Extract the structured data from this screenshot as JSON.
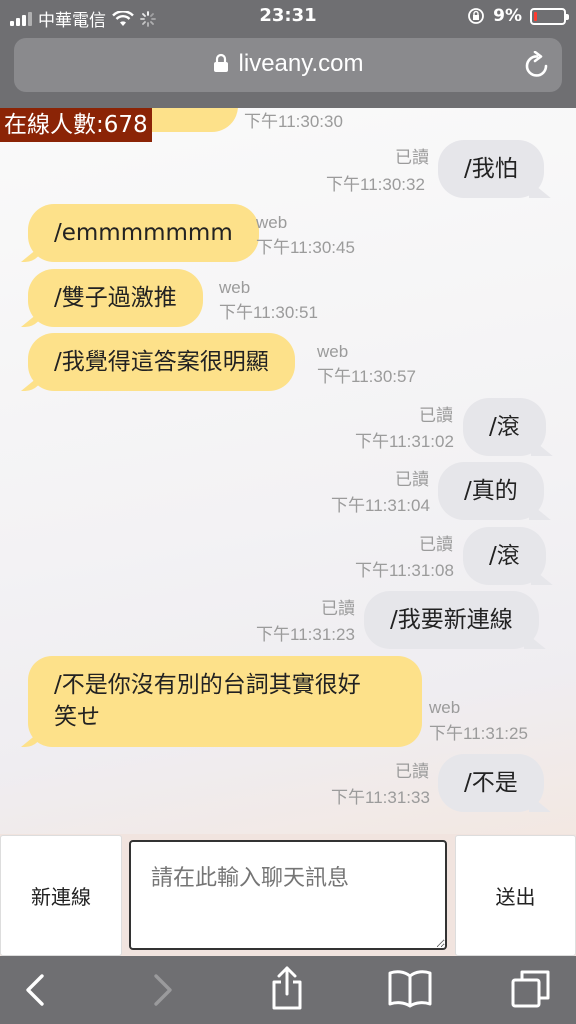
{
  "status_bar": {
    "carrier": "中華電信",
    "time": "23:31",
    "battery_percent": "9%",
    "battery_level": 0.09
  },
  "browser": {
    "url": "liveany.com"
  },
  "chat": {
    "online_count": "在線人數:678",
    "messages": [
      {
        "side": "left",
        "text": "/...",
        "read": "",
        "source": "",
        "time": "下午11:30:30"
      },
      {
        "side": "right",
        "text": "/我怕",
        "read": "已讀",
        "time": "下午11:30:32"
      },
      {
        "side": "left",
        "text": "/emmmmmmm",
        "source": "web",
        "time": "下午11:30:45"
      },
      {
        "side": "left",
        "text": "/雙子過激推",
        "source": "web",
        "time": "下午11:30:51"
      },
      {
        "side": "left",
        "text": "/我覺得這答案很明顯",
        "source": "web",
        "time": "下午11:30:57"
      },
      {
        "side": "right",
        "text": "/滾",
        "read": "已讀",
        "time": "下午11:31:02"
      },
      {
        "side": "right",
        "text": "/真的",
        "read": "已讀",
        "time": "下午11:31:04"
      },
      {
        "side": "right",
        "text": "/滾",
        "read": "已讀",
        "time": "下午11:31:08"
      },
      {
        "side": "right",
        "text": "/我要新連線",
        "read": "已讀",
        "time": "下午11:31:23"
      },
      {
        "side": "left",
        "text": "/不是你沒有別的台詞其實很好",
        "text2": "笑せ",
        "source": "web",
        "time": "下午11:31:25"
      },
      {
        "side": "right",
        "text": "/不是",
        "read": "已讀",
        "time": "下午11:31:33"
      }
    ]
  },
  "input_bar": {
    "new_connection_label": "新連線",
    "message_placeholder": "請在此輸入聊天訊息",
    "send_label": "送出"
  },
  "toolbar": {
    "icons": [
      "back-icon",
      "forward-icon",
      "share-icon",
      "bookmarks-icon",
      "tabs-icon"
    ]
  }
}
